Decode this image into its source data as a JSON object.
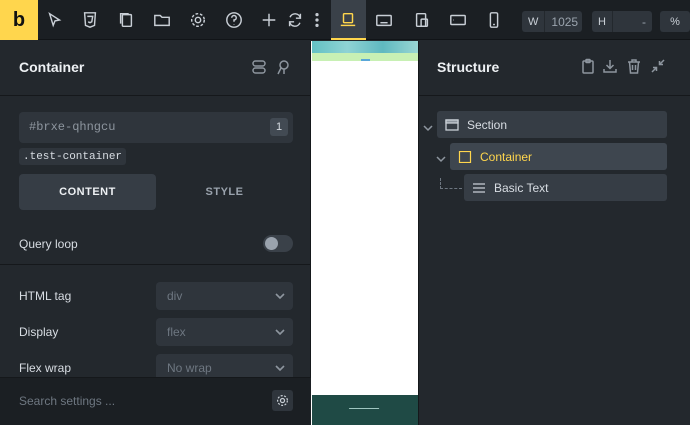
{
  "toolbar": {
    "logo": "b",
    "icons": [
      "cursor-icon",
      "css3-icon",
      "pages-icon",
      "folder-icon",
      "gear-icon",
      "help-icon",
      "add-icon",
      "refresh-icon",
      "more-icon",
      "laptop-icon",
      "desktop-landscape-icon",
      "tablet-icon",
      "tablet-landscape-icon",
      "mobile-icon"
    ],
    "width_label": "W",
    "width_value": "1025",
    "height_label": "H",
    "height_value": "-",
    "percent_label": "%"
  },
  "left_panel": {
    "title": "Container",
    "element_id": "#brxe-qhngcu",
    "id_count": "1",
    "class_chip": ".test-container",
    "tabs": {
      "content": "CONTENT",
      "style": "STYLE"
    },
    "query_loop_label": "Query loop",
    "query_loop_on": false,
    "fields": [
      {
        "label": "HTML tag",
        "value": "div"
      },
      {
        "label": "Display",
        "value": "flex"
      },
      {
        "label": "Flex wrap",
        "value": "No wrap"
      }
    ],
    "search_placeholder": "Search settings ..."
  },
  "structure_panel": {
    "title": "Structure",
    "nodes": [
      {
        "label": "Section",
        "icon": "section-icon",
        "selected": false
      },
      {
        "label": "Container",
        "icon": "container-icon",
        "selected": true
      },
      {
        "label": "Basic Text",
        "icon": "text-lines-icon",
        "selected": false
      }
    ]
  },
  "colors": {
    "accent": "#ffd64d",
    "background": "#23282d",
    "toolbar": "#1b1f23"
  }
}
